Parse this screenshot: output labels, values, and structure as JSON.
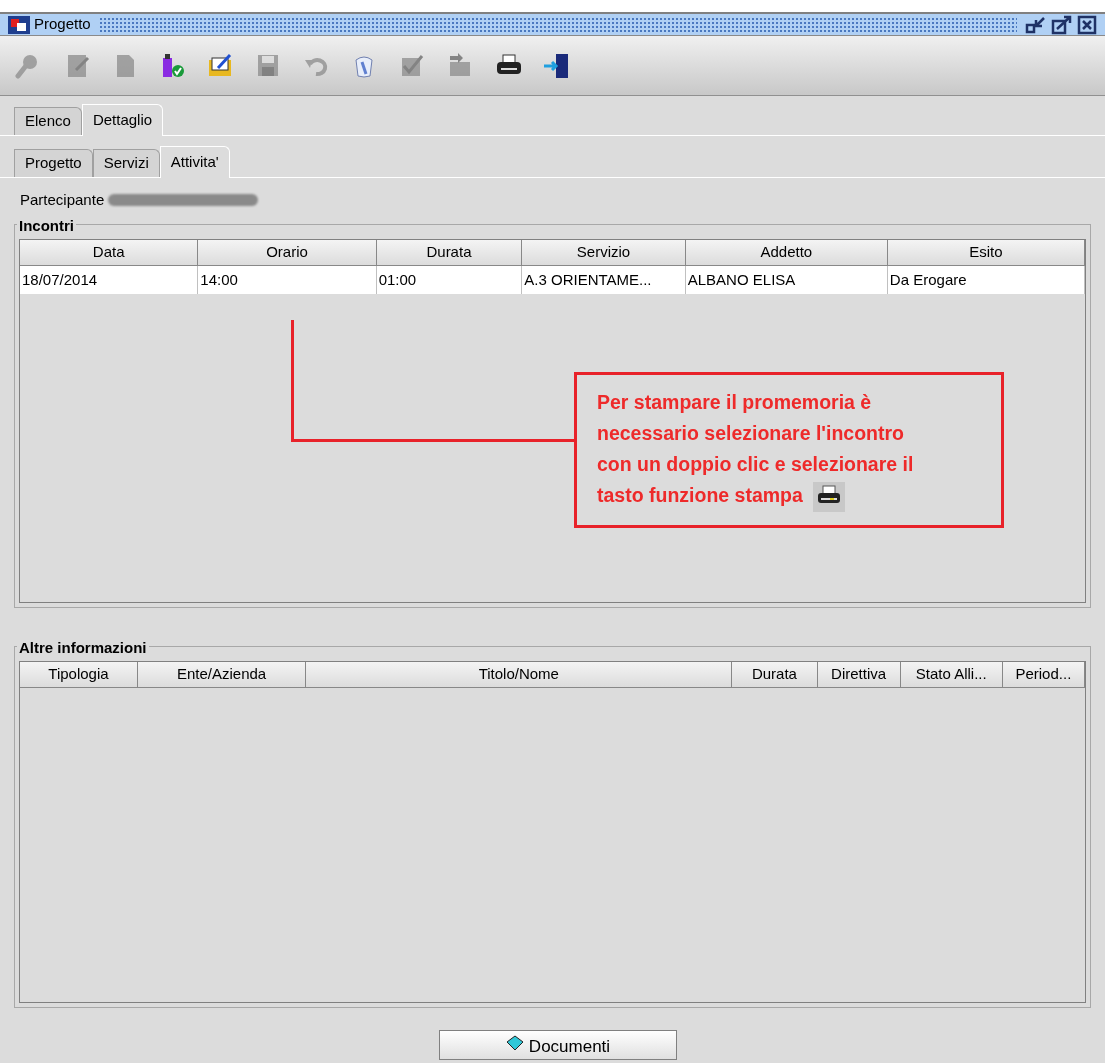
{
  "window": {
    "title": "Progetto"
  },
  "toolbar": [
    {
      "disabled": true
    },
    {
      "disabled": true
    },
    {
      "disabled": true
    },
    {
      "disabled": false
    },
    {
      "disabled": false
    },
    {
      "disabled": true
    },
    {
      "disabled": true
    },
    {
      "disabled": false
    },
    {
      "disabled": true
    },
    {
      "disabled": true
    },
    {
      "disabled": false
    },
    {
      "disabled": false
    }
  ],
  "main_tabs": [
    {
      "label": "Elenco",
      "selected": false
    },
    {
      "label": "Dettaglio",
      "selected": true
    }
  ],
  "sub_tabs": [
    {
      "label": "Progetto",
      "selected": false
    },
    {
      "label": "Servizi",
      "selected": false
    },
    {
      "label": "Attivita'",
      "selected": true
    }
  ],
  "participant": {
    "label": "Partecipante"
  },
  "incontri": {
    "title": "Incontri",
    "columns": [
      "Data",
      "Orario",
      "Durata",
      "Servizio",
      "Addetto",
      "Esito"
    ],
    "rows": [
      [
        "18/07/2014",
        "14:00",
        "01:00",
        "A.3 ORIENTAME...",
        "ALBANO ELISA",
        "Da Erogare"
      ]
    ]
  },
  "annotation": {
    "text": "Per stampare il promemoria è necessario selezionare  l'incontro con un doppio clic e selezionare il tasto funzione stampa"
  },
  "altre_informazioni": {
    "title": "Altre informazioni",
    "columns": [
      "Tipologia",
      "Ente/Azienda",
      "Titolo/Nome",
      "Durata",
      "Direttiva",
      "Stato Alli...",
      "Period..."
    ]
  },
  "buttons": [
    {
      "label": "Documenti"
    }
  ]
}
